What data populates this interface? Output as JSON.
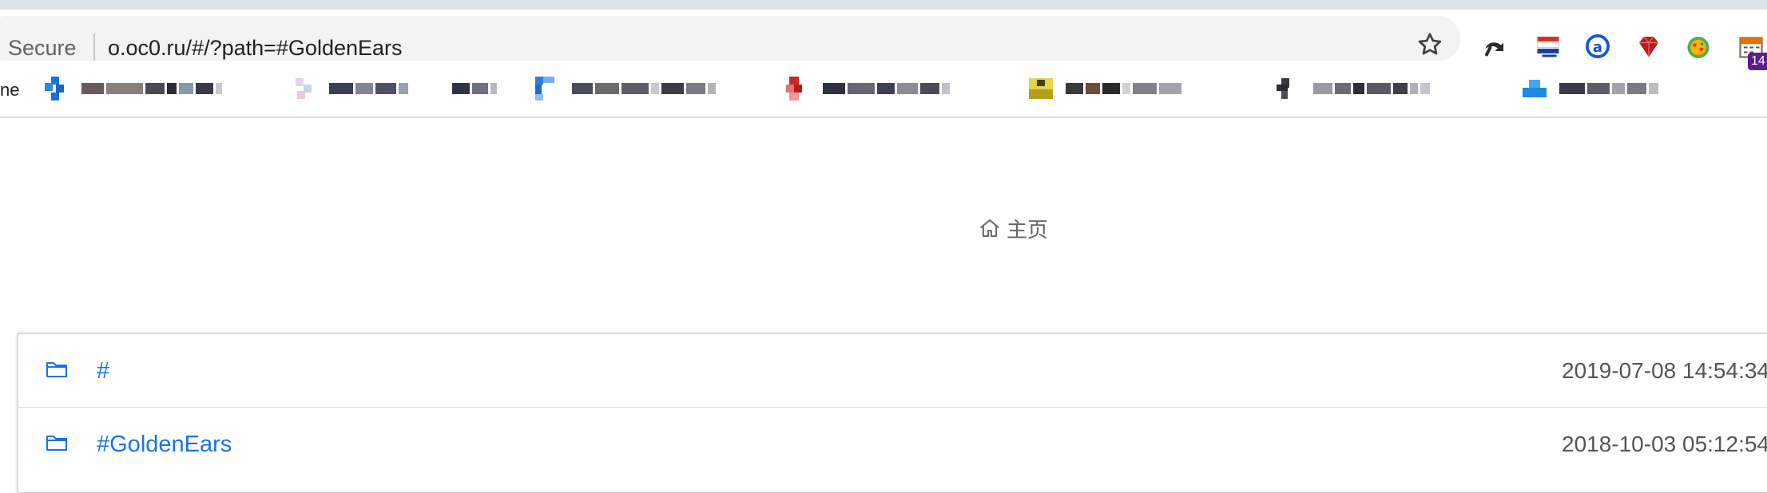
{
  "browser": {
    "omnibox": {
      "security_label": "Secure",
      "url": "o.oc0.ru/#/?path=#GoldenEars"
    },
    "star_icon": "star-outline-icon",
    "extensions": [
      {
        "name": "undo-icon"
      },
      {
        "name": "flag-icon"
      },
      {
        "name": "a-circle-icon"
      },
      {
        "name": "ruby-icon"
      },
      {
        "name": "fruit-icon"
      },
      {
        "name": "calendar-icon",
        "badge": "14"
      }
    ],
    "bookmarks_bar": {
      "first_partial_label": "ne",
      "items_blurred": true
    }
  },
  "page": {
    "home": {
      "label": "主页",
      "icon": "home-icon"
    },
    "files": [
      {
        "name": "#",
        "date": "2019-07-08 14:54:34",
        "icon": "folder-icon"
      },
      {
        "name": "#GoldenEars",
        "date": "2018-10-03 05:12:54",
        "icon": "folder-icon"
      }
    ]
  },
  "colors": {
    "link": "#1a73e8",
    "date_text": "#555555",
    "toolbar_bg": "#f1f3f4"
  }
}
